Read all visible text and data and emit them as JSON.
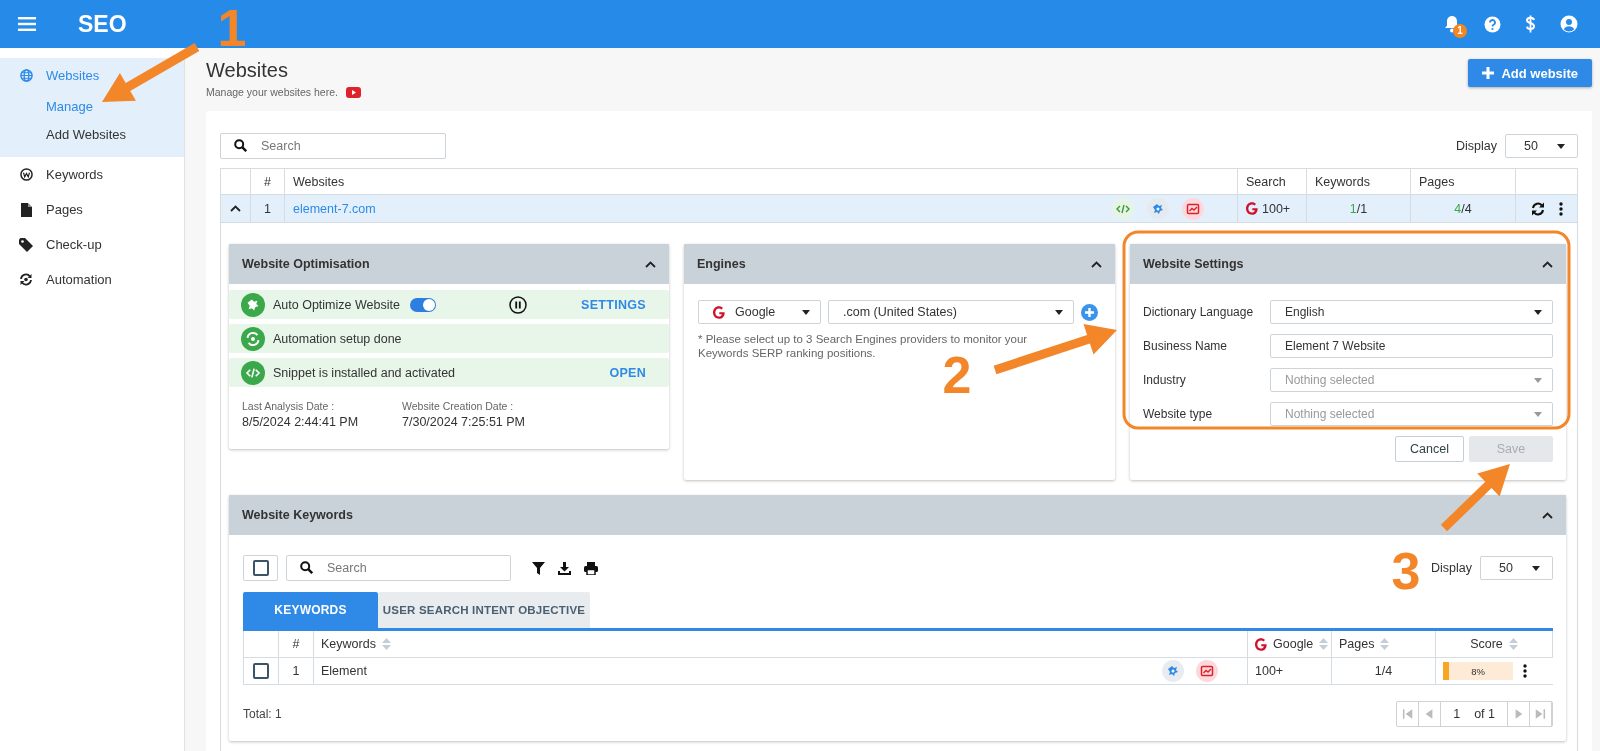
{
  "header": {
    "title": "SEO",
    "notifications": "1"
  },
  "sidebar": {
    "items": [
      {
        "label": "Websites",
        "selected": true,
        "expanded": true,
        "children": [
          {
            "label": "Manage",
            "selected": true
          },
          {
            "label": "Add Websites",
            "selected": false
          }
        ]
      },
      {
        "label": "Keywords",
        "selected": false
      },
      {
        "label": "Pages",
        "selected": false
      },
      {
        "label": "Check-up",
        "selected": false
      },
      {
        "label": "Automation",
        "selected": false
      }
    ]
  },
  "page": {
    "title": "Websites",
    "subtitle": "Manage your websites here.",
    "add_button": "Add website"
  },
  "websites_table": {
    "search": {
      "placeholder": "Search"
    },
    "display": {
      "label": "Display",
      "value": "50"
    },
    "columns": [
      "#",
      "Websites",
      "Search",
      "Keywords",
      "Pages"
    ],
    "rows": [
      {
        "expanded": true,
        "number": "1",
        "website": "element-7.com",
        "search": "100+",
        "keywords": {
          "found": "1",
          "total": "/1"
        },
        "pages": {
          "found": "4",
          "total": "/4"
        }
      }
    ]
  },
  "optimisation": {
    "title": "Website Optimisation",
    "items": [
      {
        "kind": "toggle",
        "label": "Auto Optimize Website",
        "on": true,
        "action": "SETTINGS"
      },
      {
        "kind": "status",
        "label": "Automation setup done"
      },
      {
        "kind": "status",
        "label": "Snippet is installed and activated",
        "action": "OPEN"
      }
    ],
    "dates": [
      {
        "label": "Last Analysis Date :",
        "value": "8/5/2024 2:44:41 PM"
      },
      {
        "label": "Website Creation Date :",
        "value": "7/30/2024 7:25:51 PM"
      }
    ]
  },
  "engines": {
    "title": "Engines",
    "engine": "Google",
    "location": ".com (United States)",
    "note": "* Please select up to 3 Search Engines providers to monitor your Keywords SERP ranking positions."
  },
  "settings": {
    "title": "Website Settings",
    "fields": [
      {
        "kind": "select",
        "label": "Dictionary Language",
        "value": "English"
      },
      {
        "kind": "text",
        "label": "Business Name",
        "value": "Element 7 Website"
      },
      {
        "kind": "select",
        "label": "Industry",
        "placeholder": "Nothing selected"
      },
      {
        "kind": "select",
        "label": "Website type",
        "placeholder": "Nothing selected"
      }
    ],
    "buttons": [
      {
        "label": "Cancel",
        "disabled": false
      },
      {
        "label": "Save",
        "disabled": true
      }
    ]
  },
  "keywords": {
    "title": "Website Keywords",
    "select_all_checked": false,
    "search": {
      "placeholder": "Search"
    },
    "display": {
      "label": "Display",
      "value": "50"
    },
    "tabs": [
      {
        "label": "KEYWORDS",
        "selected": true
      },
      {
        "label": "USER SEARCH INTENT OBJECTIVE",
        "selected": false
      }
    ],
    "columns": [
      "#",
      "Keywords",
      "Google",
      "Pages",
      "Score"
    ],
    "rows": [
      {
        "checked": false,
        "number": "1",
        "keyword": "Element",
        "google": "100+",
        "pages": "1/4",
        "score": "8%",
        "level": 0.08
      }
    ],
    "total": "Total: 1",
    "pagination": {
      "page": "1",
      "of": "of 1"
    }
  },
  "annotations": [
    {
      "label": "1"
    },
    {
      "label": "2"
    },
    {
      "label": "3"
    }
  ]
}
